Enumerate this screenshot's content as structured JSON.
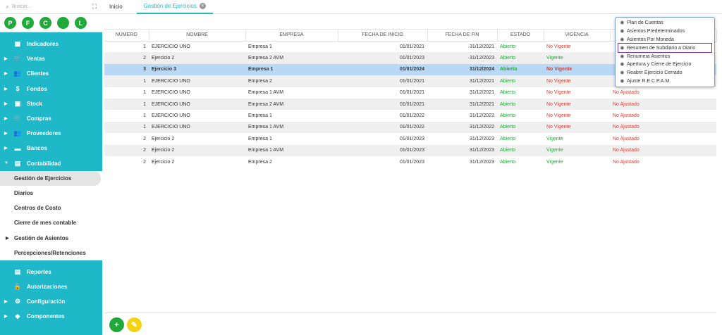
{
  "sidebar": {
    "search_placeholder": "Buscar...",
    "avatars": [
      "P",
      "F",
      "C",
      "",
      "L"
    ],
    "menu_top": [
      {
        "label": "Indicadores",
        "caret": false,
        "icon": "dashboard-icon",
        "glyph": "▦"
      },
      {
        "label": "Ventas",
        "caret": true,
        "icon": "cart-icon",
        "glyph": "🛒"
      },
      {
        "label": "Clientes",
        "caret": true,
        "icon": "users-icon",
        "glyph": "👥"
      },
      {
        "label": "Fondos",
        "caret": true,
        "icon": "dollar-icon",
        "glyph": "$"
      },
      {
        "label": "Stock",
        "caret": true,
        "icon": "box-icon",
        "glyph": "▣"
      },
      {
        "label": "Compras",
        "caret": true,
        "icon": "cart-plus-icon",
        "glyph": "🛒"
      },
      {
        "label": "Proveedores",
        "caret": true,
        "icon": "users-icon",
        "glyph": "👥"
      },
      {
        "label": "Bancos",
        "caret": true,
        "icon": "bank-icon",
        "glyph": "▬"
      },
      {
        "label": "Contabilidad",
        "caret": true,
        "expanded": true,
        "icon": "ledger-icon",
        "glyph": "▤"
      }
    ],
    "submenu": [
      {
        "label": "Gestión de Ejercicios",
        "active": true
      },
      {
        "label": "Diarios"
      },
      {
        "label": "Centros de Costo"
      },
      {
        "label": "Cierre de mes contable"
      },
      {
        "label": "Gestión de Asientos",
        "caret": true
      },
      {
        "label": "Percepciones/Retenciones"
      }
    ],
    "menu_bottom": [
      {
        "label": "Reportes",
        "caret": false,
        "icon": "report-icon",
        "glyph": "▤"
      },
      {
        "label": "Autorizaciones",
        "caret": false,
        "icon": "lock-icon",
        "glyph": "🔒"
      },
      {
        "label": "Configuración",
        "caret": true,
        "icon": "gear-icon",
        "glyph": "⚙"
      },
      {
        "label": "Componentes",
        "caret": true,
        "icon": "tag-icon",
        "glyph": "◆"
      }
    ]
  },
  "tabs": {
    "home": "Inicio",
    "active": "Gestión de Ejercicios"
  },
  "table": {
    "headers": [
      "NÚMERO",
      "NOMBRE",
      "EMPRESA",
      "FECHA DE INICIO",
      "FECHA DE FIN",
      "ESTADO",
      "VIGENCIA",
      ""
    ],
    "rows": [
      {
        "num": "1",
        "nombre": "EJERCICIO UNO",
        "empresa": "Empresa 1",
        "inicio": "01/01/2021",
        "fin": "31/12/2021",
        "estado": "Abierto",
        "vigencia": "No Vigente",
        "ajuste": ""
      },
      {
        "num": "2",
        "nombre": "Ejercicio 2",
        "empresa": "Empresa 2 AVM",
        "inicio": "01/01/2023",
        "fin": "31/12/2023",
        "estado": "Abierto",
        "vigencia": "Vigente",
        "ajuste": ""
      },
      {
        "num": "3",
        "nombre": "Ejercicio 3",
        "empresa": "Empresa 1",
        "inicio": "01/01/2024",
        "fin": "31/12/2024",
        "estado": "Abierto",
        "vigencia": "No Vigente",
        "ajuste": ""
      },
      {
        "num": "1",
        "nombre": "EJERCICIO UNO",
        "empresa": "Empresa 2",
        "inicio": "01/01/2021",
        "fin": "31/12/2021",
        "estado": "Abierto",
        "vigencia": "No Vigente",
        "ajuste": ""
      },
      {
        "num": "1",
        "nombre": "EJERCICIO UNO",
        "empresa": "Empresa 1 AVM",
        "inicio": "01/01/2021",
        "fin": "31/12/2021",
        "estado": "Abierto",
        "vigencia": "No Vigente",
        "ajuste": "No Ajustado"
      },
      {
        "num": "1",
        "nombre": "EJERCICIO UNO",
        "empresa": "Empresa 2 AVM",
        "inicio": "01/01/2021",
        "fin": "31/12/2021",
        "estado": "Abierto",
        "vigencia": "No Vigente",
        "ajuste": "No Ajustado"
      },
      {
        "num": "1",
        "nombre": "EJERCICIO UNO",
        "empresa": "Empresa 1",
        "inicio": "01/01/2022",
        "fin": "31/12/2022",
        "estado": "Abierto",
        "vigencia": "No Vigente",
        "ajuste": "No Ajustado"
      },
      {
        "num": "1",
        "nombre": "EJERCICIO UNO",
        "empresa": "Empresa 1 AVM",
        "inicio": "01/01/2022",
        "fin": "31/12/2022",
        "estado": "Abierto",
        "vigencia": "No Vigente",
        "ajuste": "No Ajustado"
      },
      {
        "num": "2",
        "nombre": "Ejercicio 2",
        "empresa": "Empresa 1",
        "inicio": "01/01/2023",
        "fin": "31/12/2023",
        "estado": "Abierto",
        "vigencia": "Vigente",
        "ajuste": "No Ajustado"
      },
      {
        "num": "2",
        "nombre": "Ejercicio 2",
        "empresa": "Empresa 1 AVM",
        "inicio": "01/01/2023",
        "fin": "31/12/2023",
        "estado": "Abierto",
        "vigencia": "Vigente",
        "ajuste": "No Ajustado"
      },
      {
        "num": "2",
        "nombre": "Ejercicio 2",
        "empresa": "Empresa 2",
        "inicio": "01/01/2023",
        "fin": "31/12/2023",
        "estado": "Abierto",
        "vigencia": "Vigente",
        "ajuste": "No Ajustado"
      }
    ],
    "selected_index": 2
  },
  "context_menu": {
    "items": [
      {
        "label": "Plan de Cuentas"
      },
      {
        "label": "Asientos Predeterminados"
      },
      {
        "label": "Asientos Por Moneda"
      },
      {
        "label": "Resumen de Subdiario a Diario",
        "highlighted": true
      },
      {
        "label": "Renumera Asientos"
      },
      {
        "label": "Apertura y Cierre de Ejercicio"
      },
      {
        "label": "Reabrir Ejercicio Cerrado"
      },
      {
        "label": "Ajuste R.E.C.P.A.M."
      }
    ]
  },
  "actions": {
    "add_symbol": "+",
    "edit_symbol": "✎"
  },
  "colors": {
    "sidebar": "#1fb8c9",
    "avatar": "#21a83a",
    "selected_row": "#b9d8f5",
    "status_green": "#22a83a",
    "status_red": "#e23b2b",
    "fab_add": "#21a83a",
    "fab_edit": "#f5d314"
  }
}
